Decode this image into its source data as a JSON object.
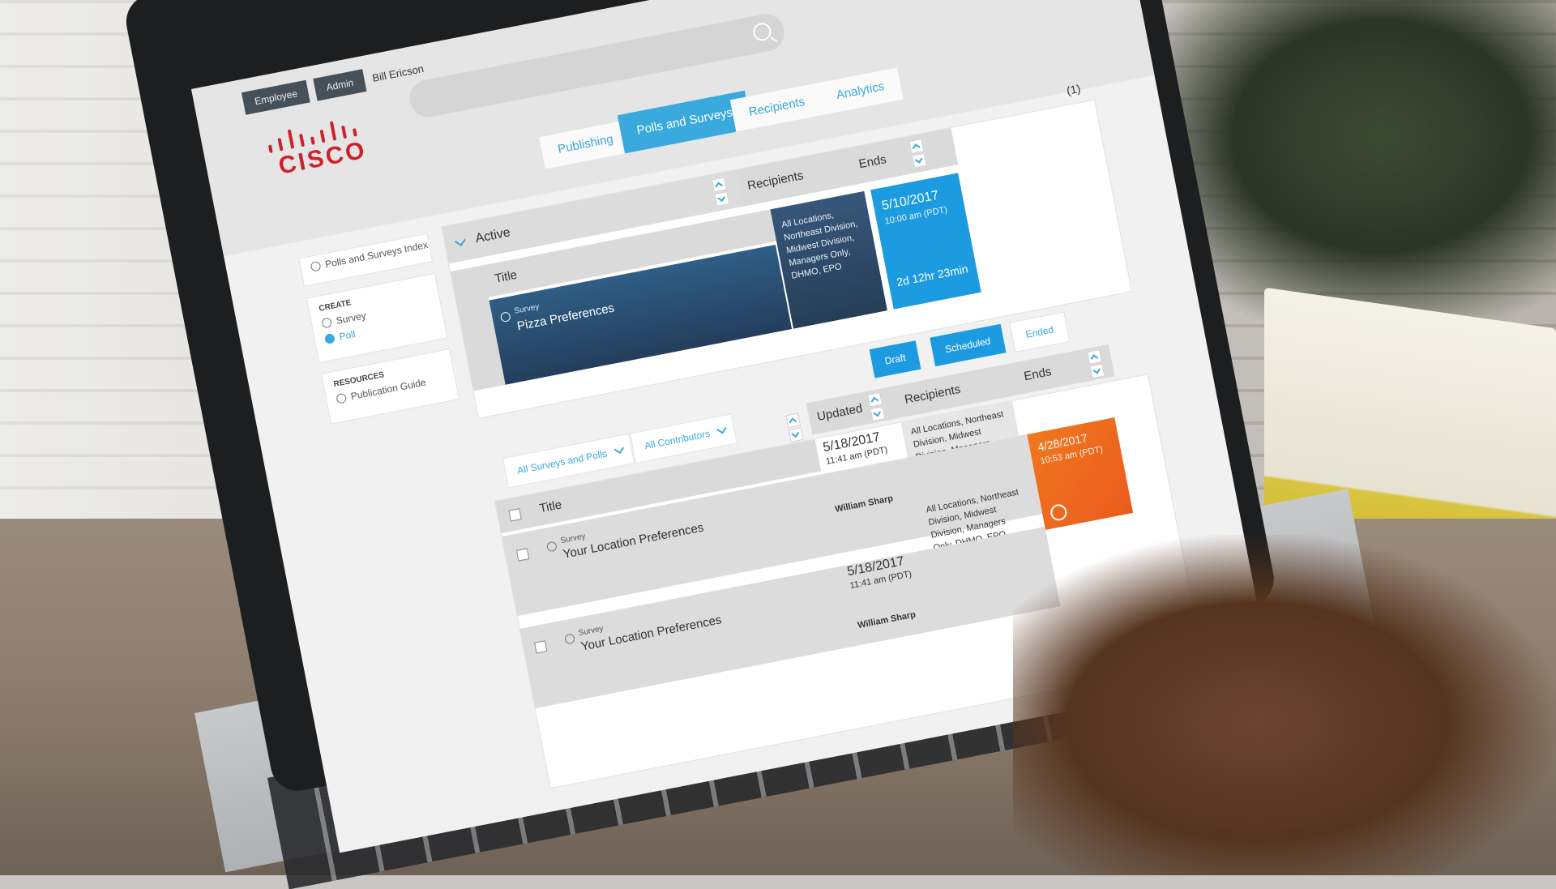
{
  "header": {
    "roles": [
      "Employee",
      "Admin"
    ],
    "user_name": "Bill Ericson",
    "brand": "CISCO",
    "tabs": [
      {
        "label": "Publishing",
        "active": false
      },
      {
        "label": "Polls and Surveys",
        "active": true
      },
      {
        "label": "Recipients",
        "active": false
      },
      {
        "label": "Analytics",
        "active": false
      }
    ]
  },
  "sidebar": {
    "index_label": "Polls and Surveys Index",
    "create_heading": "CREATE",
    "create_items": [
      {
        "label": "Survey",
        "selected": false
      },
      {
        "label": "Poll",
        "selected": true
      }
    ],
    "resources_heading": "RESOURCES",
    "resources_items": [
      "Publication Guide"
    ]
  },
  "active_panel": {
    "count": "(1)",
    "section_label": "Active",
    "col_title": "Title",
    "col_recipients": "Recipients",
    "col_ends": "Ends",
    "row": {
      "type": "Survey",
      "title": "Pizza Preferences",
      "recipients": "All Locations, Northeast Division, Midwest Division, Managers Only, DHMO, EPO",
      "end_date": "5/10/2017",
      "end_time": "10:00 am (PDT)",
      "remaining": "2d 12hr 23min"
    }
  },
  "filters": {
    "status_buttons": [
      "Draft",
      "Scheduled",
      "Ended"
    ],
    "type_filter": "All Surveys and Polls",
    "contributor_filter": "All Contributors"
  },
  "list_panel": {
    "col_title": "Title",
    "col_updated": "Updated",
    "col_recipients": "Recipients",
    "col_ends": "Ends",
    "header_recipients": "All Locations, Northeast Division, Midwest Division, Managers Only, DHMO, EPO",
    "rows": [
      {
        "type": "Survey",
        "title": "Your Location Preferences",
        "updated_date": "5/18/2017",
        "updated_time": "11:41 am (PDT)",
        "author": "William Sharp",
        "recipients": "All Locations, Northeast Division, Midwest Division, Managers Only, DHMO, EPO",
        "end_date": "4/28/2017",
        "end_time": "10:53 am (PDT)"
      },
      {
        "type": "Survey",
        "title": "Your Location Preferences",
        "updated_date": "5/18/2017",
        "updated_time": "11:41 am (PDT)",
        "author": "William Sharp"
      }
    ]
  },
  "colors": {
    "accent_blue": "#1c9be0",
    "brand_red": "#d0202a",
    "ended_orange": "#ea5b1e"
  }
}
